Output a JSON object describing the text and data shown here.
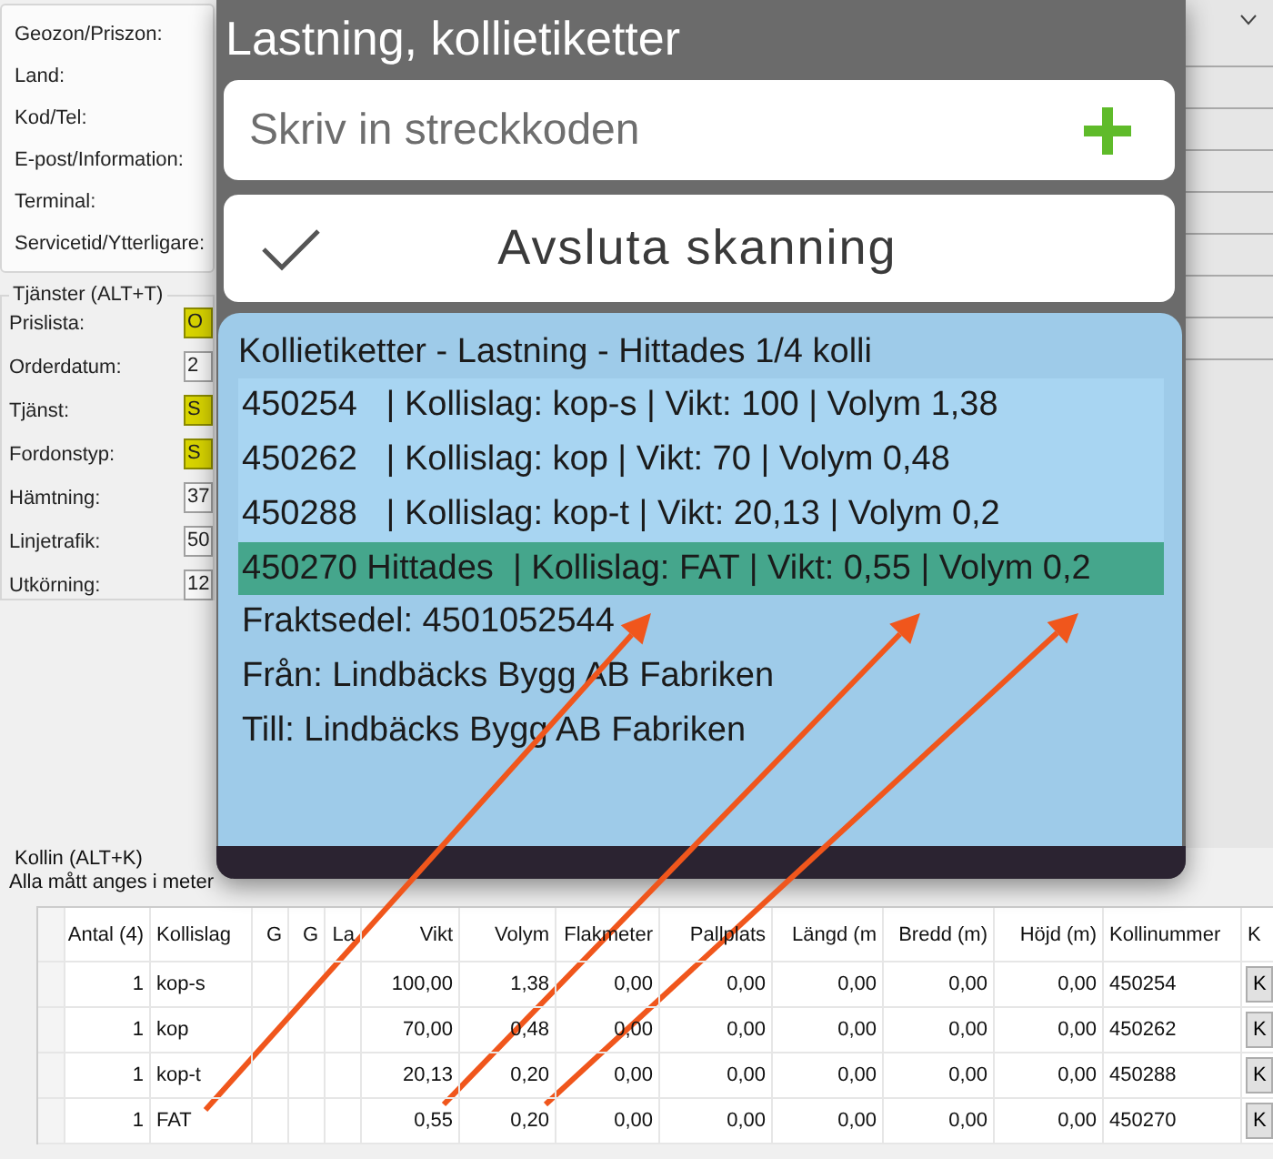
{
  "form": {
    "contact_labels": [
      "Geozon/Priszon:",
      "Land:",
      "Kod/Tel:",
      "E-post/Information:",
      "Terminal:",
      "Servicetid/Ytterligare:"
    ],
    "services_legend": "Tjänster (ALT+T)",
    "service_fields": [
      {
        "label": "Prislista:",
        "value": "O",
        "highlighted": true
      },
      {
        "label": "Orderdatum:",
        "value": "2",
        "highlighted": false
      },
      {
        "label": "Tjänst:",
        "value": "S",
        "highlighted": true
      },
      {
        "label": "Fordonstyp:",
        "value": "S",
        "highlighted": true
      },
      {
        "label": "Hämtning:",
        "value": "37",
        "highlighted": false
      },
      {
        "label": "Linjetrafik:",
        "value": "50",
        "highlighted": false
      },
      {
        "label": "Utkörning:",
        "value": "12",
        "highlighted": false
      }
    ]
  },
  "dialog": {
    "title": "Lastning, kollietiketter",
    "barcode_field": {
      "placeholder": "Skriv in streckkoden"
    },
    "finish_button": "Avsluta skanning",
    "panel": {
      "heading": "Kollietiketter - Lastning - Hittades 1/4 kolli",
      "packages": [
        {
          "text": "450254   | Kollislag: kop-s | Vikt: 100 | Volym 1,38",
          "found": false
        },
        {
          "text": "450262   | Kollislag: kop | Vikt: 70 | Volym 0,48",
          "found": false
        },
        {
          "text": "450288   | Kollislag: kop-t | Vikt: 20,13 | Volym 0,2",
          "found": false
        },
        {
          "text": "450270 Hittades  | Kollislag: FAT | Vikt: 0,55 | Volym 0,2",
          "found": true
        }
      ],
      "details": [
        "Fraktsedel: 4501052544",
        "Från: Lindbäcks Bygg AB Fabriken",
        "Till: Lindbäcks Bygg AB Fabriken"
      ]
    }
  },
  "packages_section": {
    "legend": "Kollin (ALT+K)",
    "note": "Alla mått anges i meter",
    "columns": [
      "Antal (4)",
      "Kollislag",
      "G",
      "G",
      "La",
      "Vikt",
      "Volym",
      "Flakmeter",
      "Pallplats",
      "Längd (m",
      "Bredd (m)",
      "Höjd (m)",
      "Kollinummer",
      "K"
    ],
    "rows": [
      {
        "antal": "1",
        "kollislag": "kop-s",
        "vikt": "100,00",
        "volym": "1,38",
        "flakmeter": "0,00",
        "pallplats": "0,00",
        "langd": "0,00",
        "bredd": "0,00",
        "hojd": "0,00",
        "kollinummer": "450254",
        "button": "K"
      },
      {
        "antal": "1",
        "kollislag": "kop",
        "vikt": "70,00",
        "volym": "0,48",
        "flakmeter": "0,00",
        "pallplats": "0,00",
        "langd": "0,00",
        "bredd": "0,00",
        "hojd": "0,00",
        "kollinummer": "450262",
        "button": "K"
      },
      {
        "antal": "1",
        "kollislag": "kop-t",
        "vikt": "20,13",
        "volym": "0,20",
        "flakmeter": "0,00",
        "pallplats": "0,00",
        "langd": "0,00",
        "bredd": "0,00",
        "hojd": "0,00",
        "kollinummer": "450288",
        "button": "K"
      },
      {
        "antal": "1",
        "kollislag": "FAT",
        "vikt": "0,55",
        "volym": "0,20",
        "flakmeter": "0,00",
        "pallplats": "0,00",
        "langd": "0,00",
        "bredd": "0,00",
        "hojd": "0,00",
        "kollinummer": "450270",
        "button": "K"
      }
    ]
  }
}
